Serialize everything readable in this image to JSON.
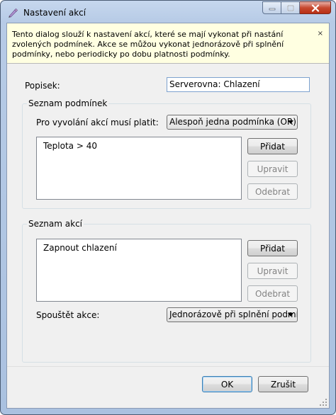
{
  "window": {
    "title": "Nastavení akcí",
    "icon": "pencil-icon"
  },
  "info": {
    "text": "Tento dialog slouží k nastavení akcí, které se mají vykonat při nastání zvolených podmínek. Akce se můžou vykonat jednorázově při splnění podmínky, nebo periodicky po dobu platnosti podmínky.",
    "close_glyph": "×"
  },
  "description": {
    "label": "Popisek:",
    "value": "Serverovna: Chlazení"
  },
  "conditions": {
    "title": "Seznam podmínek",
    "mode_label": "Pro vyvolání akcí musí platit:",
    "mode_value": "Alespoň jedna podmínka (OR)",
    "items": [
      "Teplota > 40"
    ],
    "add_label": "Přidat",
    "edit_label": "Upravit",
    "delete_label": "Odebrat"
  },
  "actions": {
    "title": "Seznam akcí",
    "items": [
      "Zapnout chlazení"
    ],
    "add_label": "Přidat",
    "edit_label": "Upravit",
    "delete_label": "Odebrat",
    "trigger_label": "Spouštět akce:",
    "trigger_value": "Jednorázově při splnění podmínky"
  },
  "footer": {
    "ok_label": "OK",
    "cancel_label": "Zrušit"
  },
  "colors": {
    "info_background": "#ffffe1",
    "close_button": "#c7492f",
    "titlebar": "#b7cbe6"
  }
}
